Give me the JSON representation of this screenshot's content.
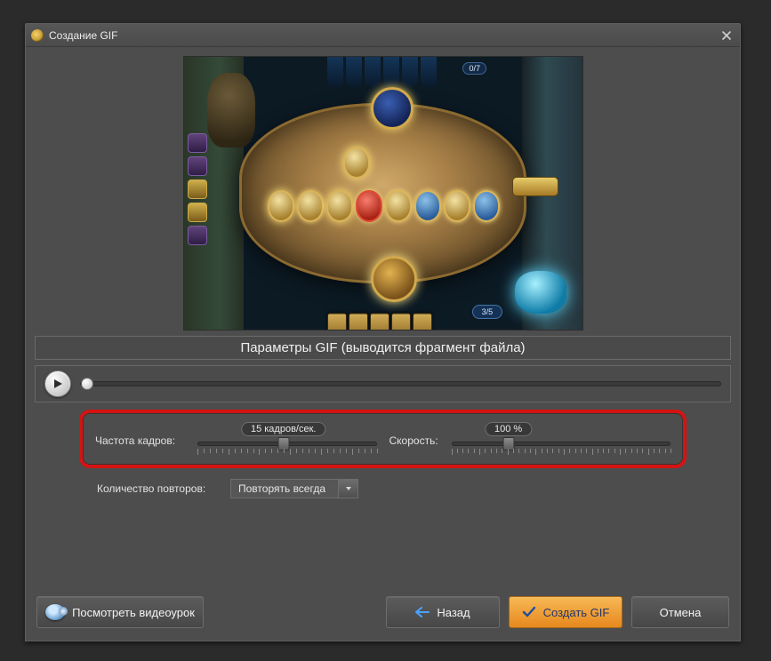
{
  "window": {
    "title": "Создание GIF",
    "close_tooltip": "Close"
  },
  "section_header": "Параметры GIF (выводится фрагмент файла)",
  "playback": {
    "position_percent": 0
  },
  "framerate": {
    "label": "Частота кадров:",
    "value_label": "15 кадров/сек.",
    "value": 15,
    "min": 1,
    "max": 30,
    "thumb_percent": 48
  },
  "speed": {
    "label": "Скорость:",
    "value_label": "100 %",
    "value": 100,
    "min": 10,
    "max": 400,
    "thumb_percent": 26
  },
  "repeat": {
    "label": "Количество повторов:",
    "selected": "Повторять всегда"
  },
  "preview": {
    "top_counter": "0/7",
    "mana": "3/5"
  },
  "buttons": {
    "tutorial": "Посмотреть видеоурок",
    "back": "Назад",
    "create": "Создать GIF",
    "cancel": "Отмена"
  }
}
